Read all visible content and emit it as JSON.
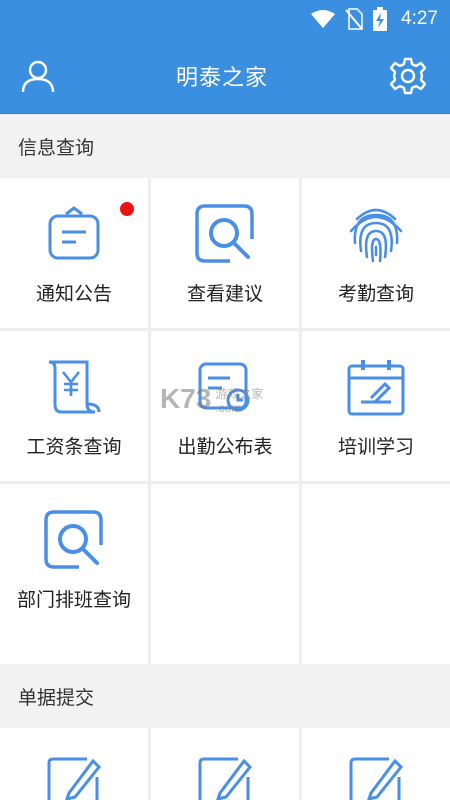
{
  "status_bar": {
    "time": "4:27"
  },
  "app_bar": {
    "title": "明泰之家"
  },
  "sections": [
    {
      "title": "信息查询",
      "items": [
        {
          "label": "通知公告",
          "icon": "notice-board-icon",
          "badge": true
        },
        {
          "label": "查看建议",
          "icon": "search-suggestion-icon"
        },
        {
          "label": "考勤查询",
          "icon": "fingerprint-icon"
        },
        {
          "label": "工资条查询",
          "icon": "salary-scroll-icon"
        },
        {
          "label": "出勤公布表",
          "icon": "attendance-table-icon"
        },
        {
          "label": "培训学习",
          "icon": "calendar-edit-icon"
        },
        {
          "label": "部门排班查询",
          "icon": "search-schedule-icon"
        }
      ]
    },
    {
      "title": "单据提交",
      "items": [
        {
          "icon": "edit-document-icon"
        },
        {
          "icon": "edit-document-icon"
        },
        {
          "icon": "edit-document-icon"
        }
      ]
    }
  ],
  "watermark": {
    "main": "K73",
    "sub1": "游戏之家",
    "sub2": ".com"
  },
  "colors": {
    "primary": "#3b8fe0",
    "icon": "#4a8fe6",
    "badge": "#ee1111"
  }
}
